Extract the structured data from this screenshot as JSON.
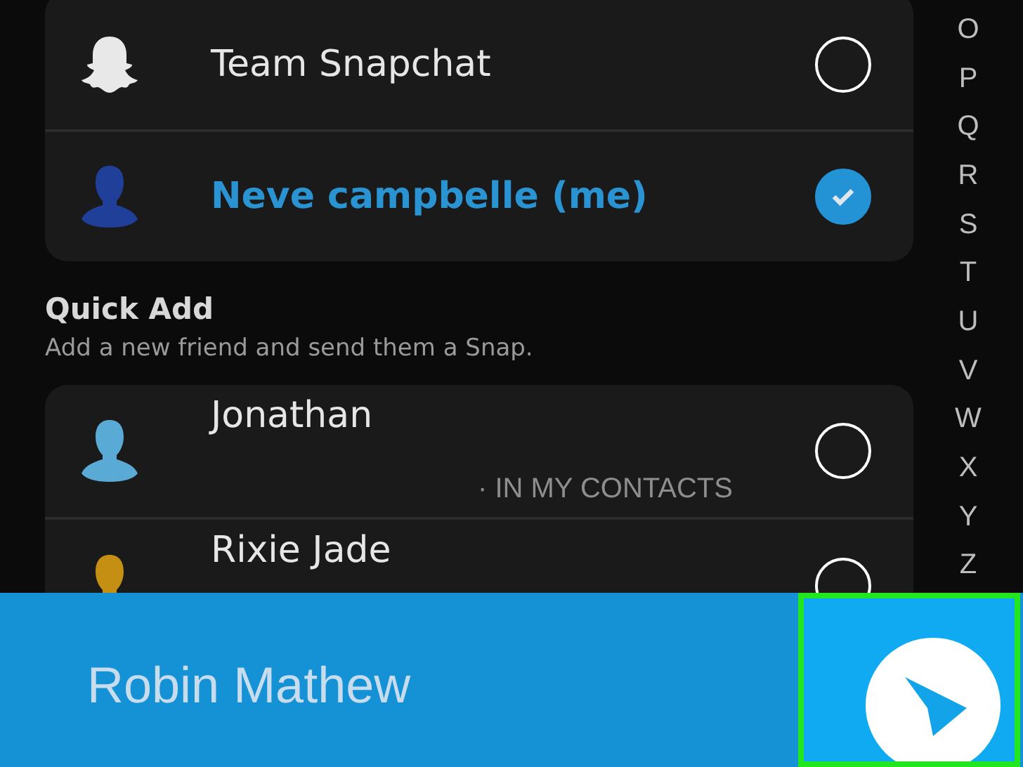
{
  "friends": [
    {
      "name": "Team Snapchat",
      "kind": "ghost",
      "color": "#e8e8e8",
      "selected": false
    },
    {
      "name": "Neve campbelle (me)",
      "kind": "person",
      "color": "#1f3f99",
      "selected": true
    }
  ],
  "quick_add": {
    "title": "Quick Add",
    "subtitle": "Add a new friend and send them a Snap.",
    "items": [
      {
        "name": "Jonathan",
        "kind": "person",
        "color": "#5aaad6",
        "note": "· IN MY CONTACTS",
        "selected": false
      },
      {
        "name": "Rixie Jade",
        "kind": "person",
        "color": "#c48f12",
        "selected": false
      }
    ]
  },
  "index": [
    "O",
    "P",
    "Q",
    "R",
    "S",
    "T",
    "U",
    "V",
    "W",
    "X",
    "Y",
    "Z"
  ],
  "send_bar": {
    "recipient": "Robin Mathew"
  }
}
